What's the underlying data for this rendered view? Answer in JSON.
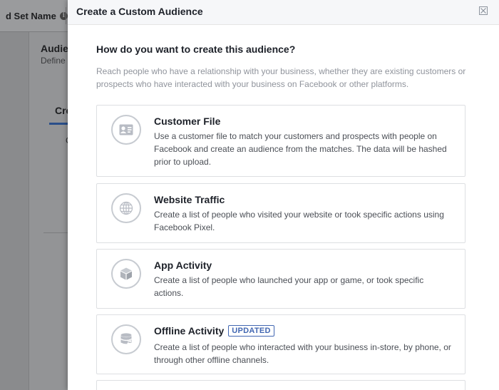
{
  "background": {
    "adset_label": "d Set Name",
    "audience_title": "Audie",
    "audience_subtitle": "Define",
    "tab_label": "Cre",
    "c_text": "C"
  },
  "modal": {
    "title": "Create a Custom Audience",
    "question": "How do you want to create this audience?",
    "intro": "Reach people who have a relationship with your business, whether they are existing customers or prospects who have interacted with your business on Facebook or other platforms.",
    "options": [
      {
        "title": "Customer File",
        "icon": "contact-card-icon",
        "description": "Use a customer file to match your customers and prospects with people on Facebook and create an audience from the matches. The data will be hashed prior to upload."
      },
      {
        "title": "Website Traffic",
        "icon": "globe-icon",
        "description": "Create a list of people who visited your website or took specific actions using Facebook Pixel."
      },
      {
        "title": "App Activity",
        "icon": "cube-icon",
        "description": "Create a list of people who launched your app or game, or took specific actions."
      },
      {
        "title": "Offline Activity",
        "icon": "database-icon",
        "badge": "UPDATED",
        "description": "Create a list of people who interacted with your business in-store, by phone, or through other offline channels."
      }
    ]
  },
  "colors": {
    "accent": "#4267b2",
    "border": "#dddfe2",
    "muted_text": "#90949c"
  }
}
